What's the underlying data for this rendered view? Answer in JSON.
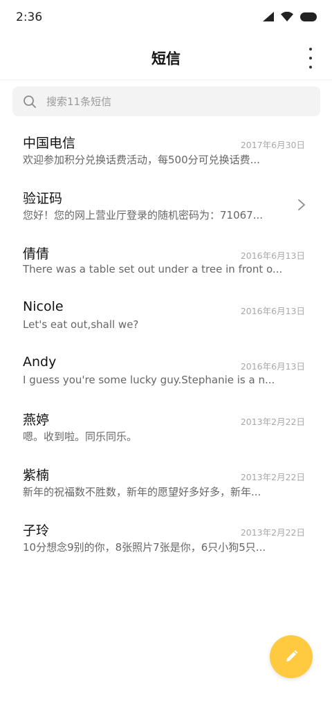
{
  "status_bar": {
    "time": "2:36",
    "icons": [
      "cellular-signal-icon",
      "wifi-icon",
      "battery-icon"
    ]
  },
  "header": {
    "title": "短信",
    "more_icon": "more-vertical-icon"
  },
  "search": {
    "placeholder": "搜索11条短信",
    "value": "",
    "icon": "search-icon"
  },
  "messages": [
    {
      "sender": "中国电信",
      "date": "2017年6月30日",
      "preview": "欢迎参加积分兑换话费活动，每500分可兑换话费..."
    },
    {
      "sender": "验证码",
      "date": "",
      "preview": "您好！您的网上营业厅登录的随机密码为：71067...",
      "icon": "chevron-right-icon"
    },
    {
      "sender": "倩倩",
      "date": "2016年6月13日",
      "preview": "There was a table set out under a tree in front o..."
    },
    {
      "sender": "Nicole",
      "date": "2016年6月13日",
      "preview": "Let's eat out,shall we?"
    },
    {
      "sender": "Andy",
      "date": "2016年6月13日",
      "preview": "I guess you're some lucky guy.Stephanie is a n..."
    },
    {
      "sender": "燕婷",
      "date": "2013年2月22日",
      "preview": "嗯。收到啦。同乐同乐。"
    },
    {
      "sender": "紫楠",
      "date": "2013年2月22日",
      "preview": "新年的祝福数不胜数，新年的愿望好多好多，新年..."
    },
    {
      "sender": "子玲",
      "date": "2013年2月22日",
      "preview": "10分想念9别的你，8张照片7张是你，6只小狗5只..."
    }
  ],
  "fab": {
    "icon": "pencil-icon"
  },
  "colors": {
    "accent": "#ffc940",
    "search_bg": "#f3f3f3",
    "date_text": "#a8a8a8",
    "preview_text": "#666666"
  }
}
